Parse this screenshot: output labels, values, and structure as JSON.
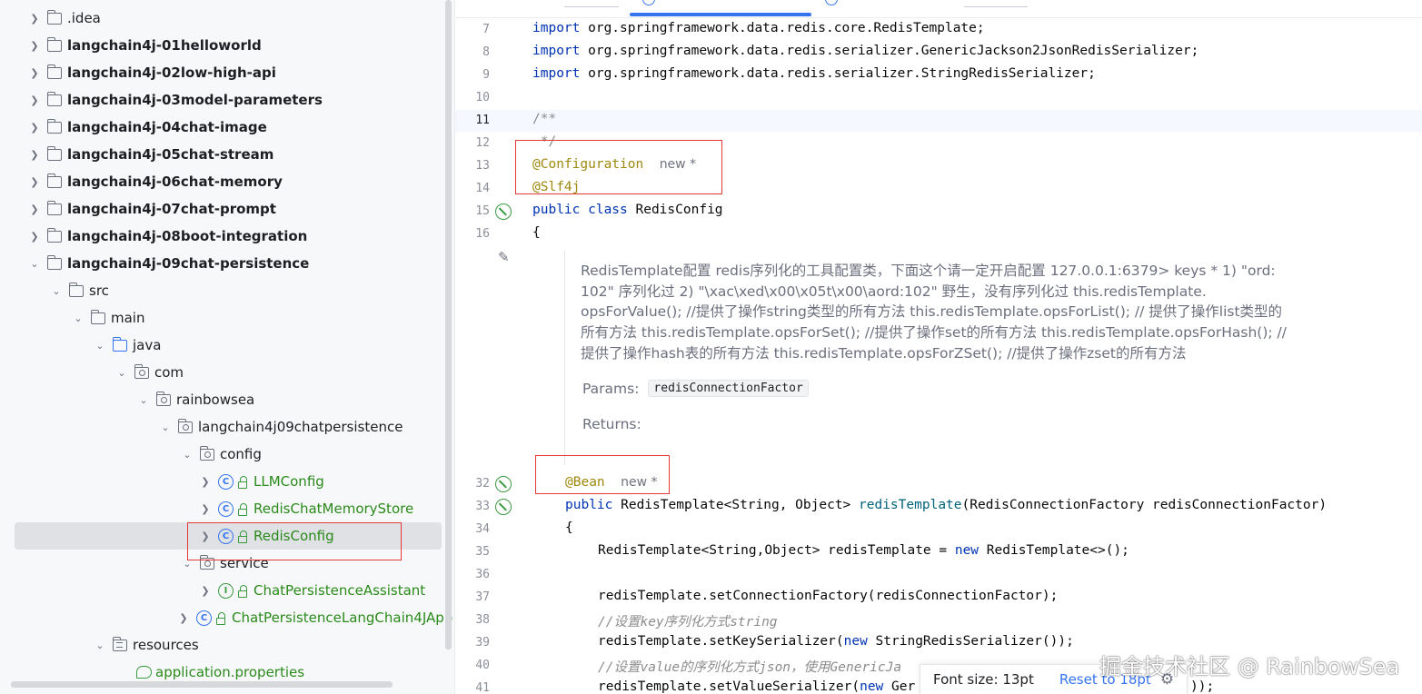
{
  "tree": {
    "items": [
      {
        "label": ".idea"
      },
      {
        "label": "langchain4j-01helloworld"
      },
      {
        "label": "langchain4j-02low-high-api"
      },
      {
        "label": "langchain4j-03model-parameters"
      },
      {
        "label": "langchain4j-04chat-image"
      },
      {
        "label": "langchain4j-05chat-stream"
      },
      {
        "label": "langchain4j-06chat-memory"
      },
      {
        "label": "langchain4j-07chat-prompt"
      },
      {
        "label": "langchain4j-08boot-integration"
      },
      {
        "label": "langchain4j-09chat-persistence"
      },
      {
        "label": "src"
      },
      {
        "label": "main"
      },
      {
        "label": "java"
      },
      {
        "label": "com"
      },
      {
        "label": "rainbowsea"
      },
      {
        "label": "langchain4j09chatpersistence"
      },
      {
        "label": "config"
      },
      {
        "label": "LLMConfig"
      },
      {
        "label": "RedisChatMemoryStore"
      },
      {
        "label": "RedisConfig"
      },
      {
        "label": "service"
      },
      {
        "label": "ChatPersistenceAssistant"
      },
      {
        "label": "ChatPersistenceLangChain4JApp"
      },
      {
        "label": "resources"
      },
      {
        "label": "application.properties"
      }
    ],
    "class_badge": "C",
    "interface_badge": "I"
  },
  "editor": {
    "line_numbers": [
      "7",
      "8",
      "9",
      "10",
      "11",
      "12",
      "13",
      "14",
      "15",
      "16",
      "32",
      "33",
      "34",
      "35",
      "36",
      "37",
      "38",
      "39",
      "40",
      "41"
    ],
    "code": {
      "l7_kw": "import",
      "l7_rest": " org.springframework.data.redis.core.RedisTemplate;",
      "l8_kw": "import",
      "l8_rest": " org.springframework.data.redis.serializer.GenericJackson2JsonRedisSerializer;",
      "l9_kw": "import",
      "l9_rest": " org.springframework.data.redis.serializer.StringRedisSerializer;",
      "l11": "/**",
      "l12": " */",
      "l13_ann": "@Configuration",
      "l13_hint": "new *",
      "l14_ann": "@Slf4j",
      "l15_kw": "public class",
      "l15_rest": " RedisConfig",
      "l16": "{",
      "l32_ann": "@Bean",
      "l32_hint": "new *",
      "l33_kw": "public",
      "l33_type": " RedisTemplate<String, Object> ",
      "l33_fn": "redisTemplate",
      "l33_rest": "(RedisConnectionFactory redisConnectionFactor)",
      "l34": "{",
      "l35_a": "RedisTemplate<String,Object> redisTemplate = ",
      "l35_kw": "new",
      "l35_b": " RedisTemplate<>();",
      "l37": "redisTemplate.setConnectionFactory(redisConnectionFactor);",
      "l38": "//设置key序列化方式string",
      "l39_a": "redisTemplate.setKeySerializer(",
      "l39_kw": "new",
      "l39_b": " StringRedisSerializer());",
      "l40": "//设置value的序列化方式json，使用GenericJa",
      "l41_a": "redisTemplate.setValueSerializer(",
      "l41_kw": "new",
      "l41_b": " Ger",
      "l41_c": "));"
    },
    "doc": {
      "lines": [
        "RedisTemplate配置 redis序列化的工具配置类，下面这个请一定开启配置 127.0.0.1:6379> keys * 1) \"ord:",
        "102\" 序列化过 2) \"\\xac\\xed\\x00\\x05t\\x00\\aord:102\" 野生，没有序列化过 this.redisTemplate.",
        "opsForValue(); //提供了操作string类型的所有方法 this.redisTemplate.opsForList(); // 提供了操作list类型的",
        "所有方法 this.redisTemplate.opsForSet(); //提供了操作set的所有方法 this.redisTemplate.opsForHash(); //",
        "提供了操作hash表的所有方法 this.redisTemplate.opsForZSet(); //提供了操作zset的所有方法"
      ],
      "params_label": "Params:",
      "param_name": "redisConnectionFactor",
      "returns_label": "Returns:"
    }
  },
  "font_popup": {
    "font_size": "Font size: 13pt",
    "reset": "Reset to 18pt"
  },
  "watermark": "掘金技术社区 @ RainbowSea"
}
